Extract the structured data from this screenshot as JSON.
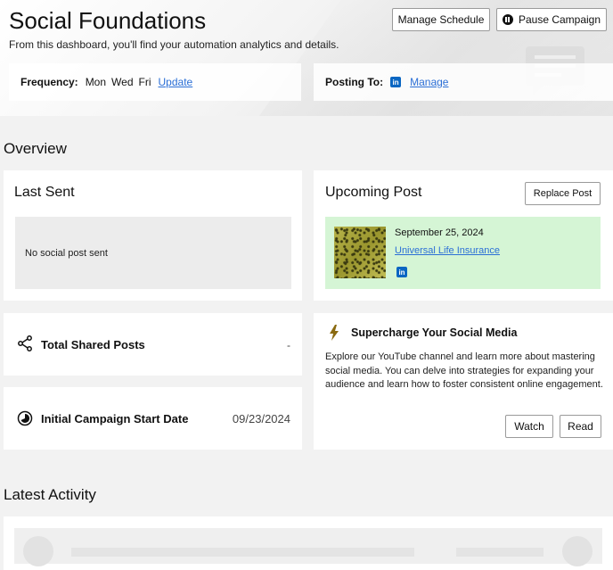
{
  "header": {
    "title": "Social Foundations",
    "subtitle": "From this dashboard, you'll find your automation analytics and details.",
    "manage_schedule_label": "Manage Schedule",
    "pause_campaign_label": "Pause Campaign"
  },
  "frequency": {
    "label": "Frequency:",
    "days": [
      "Mon",
      "Wed",
      "Fri"
    ],
    "update_link": "Update"
  },
  "posting": {
    "label": "Posting To:",
    "network_icon": "linkedin-icon",
    "manage_link": "Manage"
  },
  "overview": {
    "title": "Overview",
    "last_sent": {
      "title": "Last Sent",
      "empty_text": "No social post sent"
    },
    "upcoming": {
      "title": "Upcoming Post",
      "replace_label": "Replace Post",
      "date": "September 25, 2024",
      "post_title": "Universal Life Insurance",
      "network_icon": "linkedin-icon"
    },
    "total_shared": {
      "label": "Total Shared Posts",
      "value": "-"
    },
    "start_date": {
      "label": "Initial Campaign Start Date",
      "value": "09/23/2024"
    },
    "supercharge": {
      "title": "Supercharge Your Social Media",
      "body": "Explore our YouTube channel and learn more about mastering social media. You can delve into strategies for expanding your audience and learn how to foster consistent online engagement.",
      "watch_label": "Watch",
      "read_label": "Read"
    }
  },
  "latest_activity": {
    "title": "Latest Activity"
  },
  "colors": {
    "link": "#2b6fd6",
    "linkedin": "#0a66c2",
    "upcoming_bg": "#d5f5d5",
    "bolt": "#8a6a10"
  }
}
